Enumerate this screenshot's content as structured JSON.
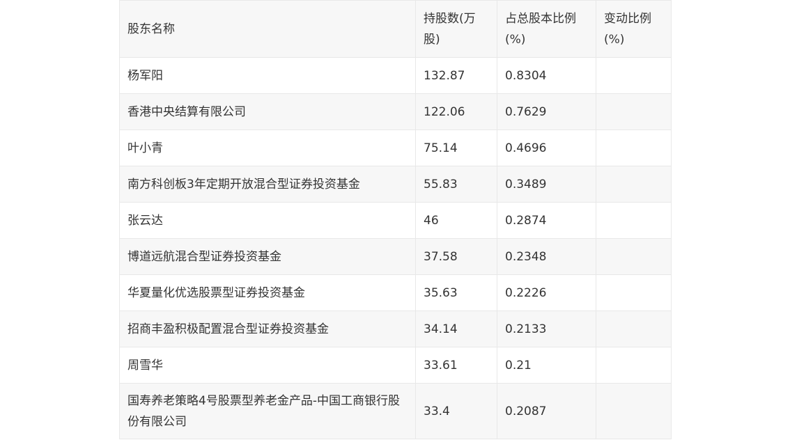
{
  "table": {
    "headers": [
      "股东名称",
      "持股数(万股)",
      "占总股本比例(%)",
      "变动比例(%)"
    ],
    "rows": [
      {
        "name": "杨军阳",
        "shares": "132.87",
        "ratio": "0.8304",
        "change": ""
      },
      {
        "name": "香港中央结算有限公司",
        "shares": "122.06",
        "ratio": "0.7629",
        "change": ""
      },
      {
        "name": "叶小青",
        "shares": "75.14",
        "ratio": "0.4696",
        "change": ""
      },
      {
        "name": "南方科创板3年定期开放混合型证券投资基金",
        "shares": "55.83",
        "ratio": "0.3489",
        "change": ""
      },
      {
        "name": "张云达",
        "shares": "46",
        "ratio": "0.2874",
        "change": ""
      },
      {
        "name": "博道远航混合型证券投资基金",
        "shares": "37.58",
        "ratio": "0.2348",
        "change": ""
      },
      {
        "name": "华夏量化优选股票型证券投资基金",
        "shares": "35.63",
        "ratio": "0.2226",
        "change": ""
      },
      {
        "name": "招商丰盈积极配置混合型证券投资基金",
        "shares": "34.14",
        "ratio": "0.2133",
        "change": ""
      },
      {
        "name": "周雪华",
        "shares": "33.61",
        "ratio": "0.21",
        "change": ""
      },
      {
        "name": "国寿养老策略4号股票型养老金产品-中国工商银行股份有限公司",
        "shares": "33.4",
        "ratio": "0.2087",
        "change": ""
      }
    ]
  }
}
